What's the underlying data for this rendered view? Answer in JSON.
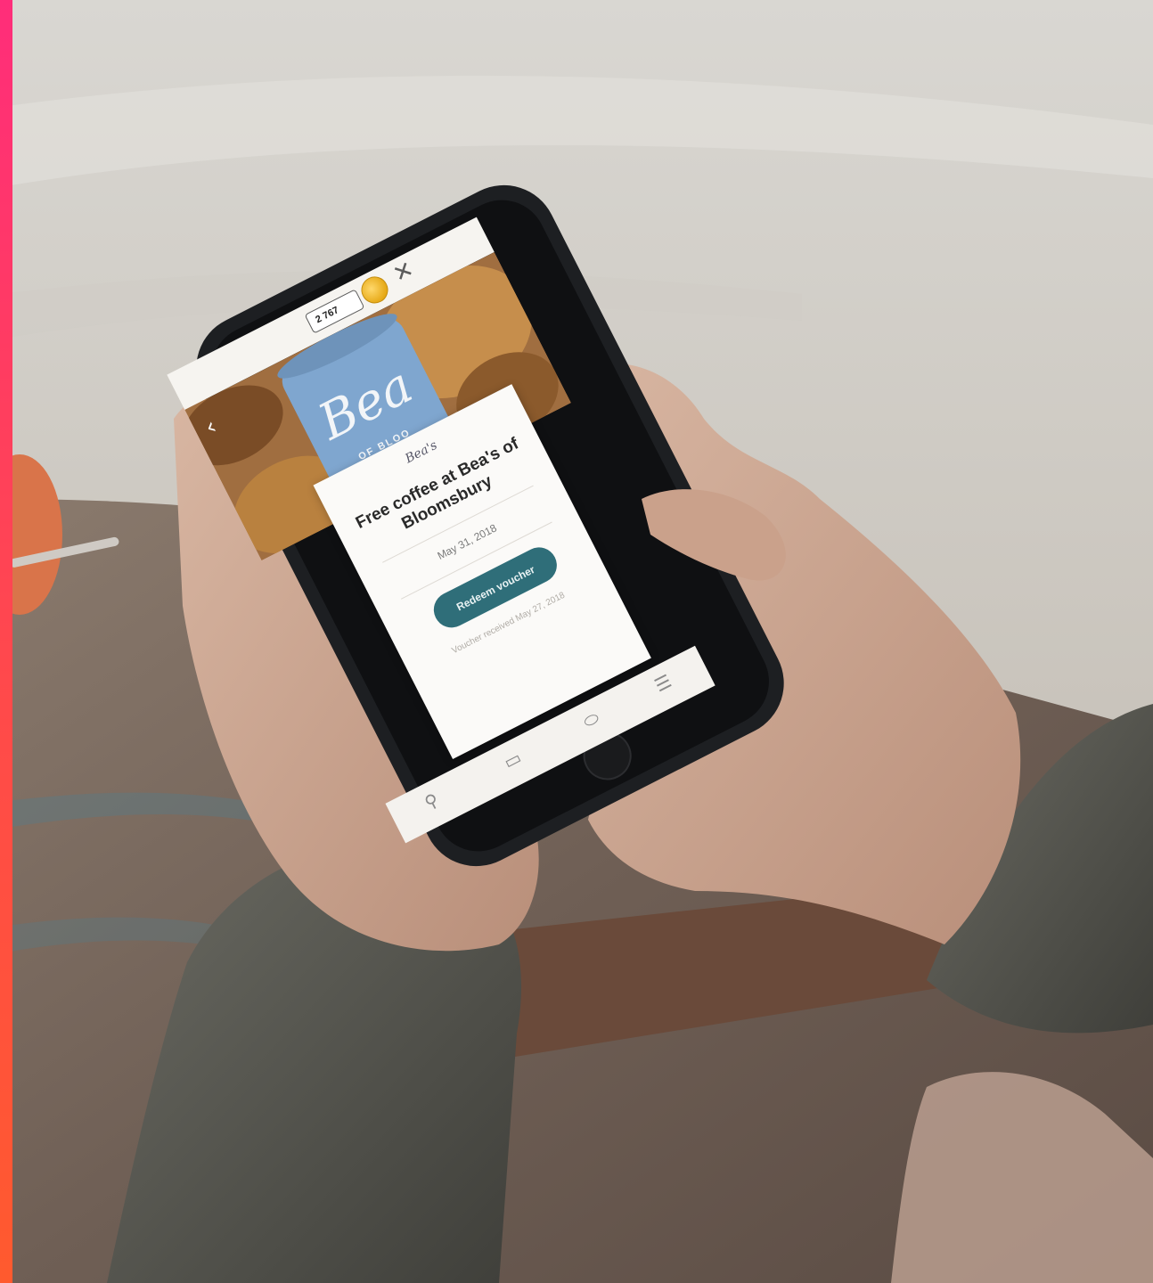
{
  "app": {
    "coin_balance": "2 767",
    "back_glyph": "‹",
    "close_glyph": "✕",
    "hero_mug_text": "Bea",
    "hero_mug_subtext": "OF BLOO",
    "brand_logo_text": "Bea's",
    "offer_title": "Free coffee at Bea's of Bloomsbury",
    "expiry_date": "May 31, 2018",
    "redeem_label": "Redeem voucher",
    "voucher_note": "Voucher received May 27, 2018",
    "nav": [
      {
        "icon": "person-icon",
        "glyph": "⚲"
      },
      {
        "icon": "card-icon",
        "glyph": "▭"
      },
      {
        "icon": "ticket-icon",
        "glyph": "⬭"
      },
      {
        "icon": "menu-icon",
        "glyph": "☰"
      }
    ]
  },
  "colors": {
    "accent_top": "#ff2d7a",
    "accent_bottom": "#ff5a2e",
    "button_teal": "#2f6e79",
    "coin_gold": "#e6a917"
  }
}
